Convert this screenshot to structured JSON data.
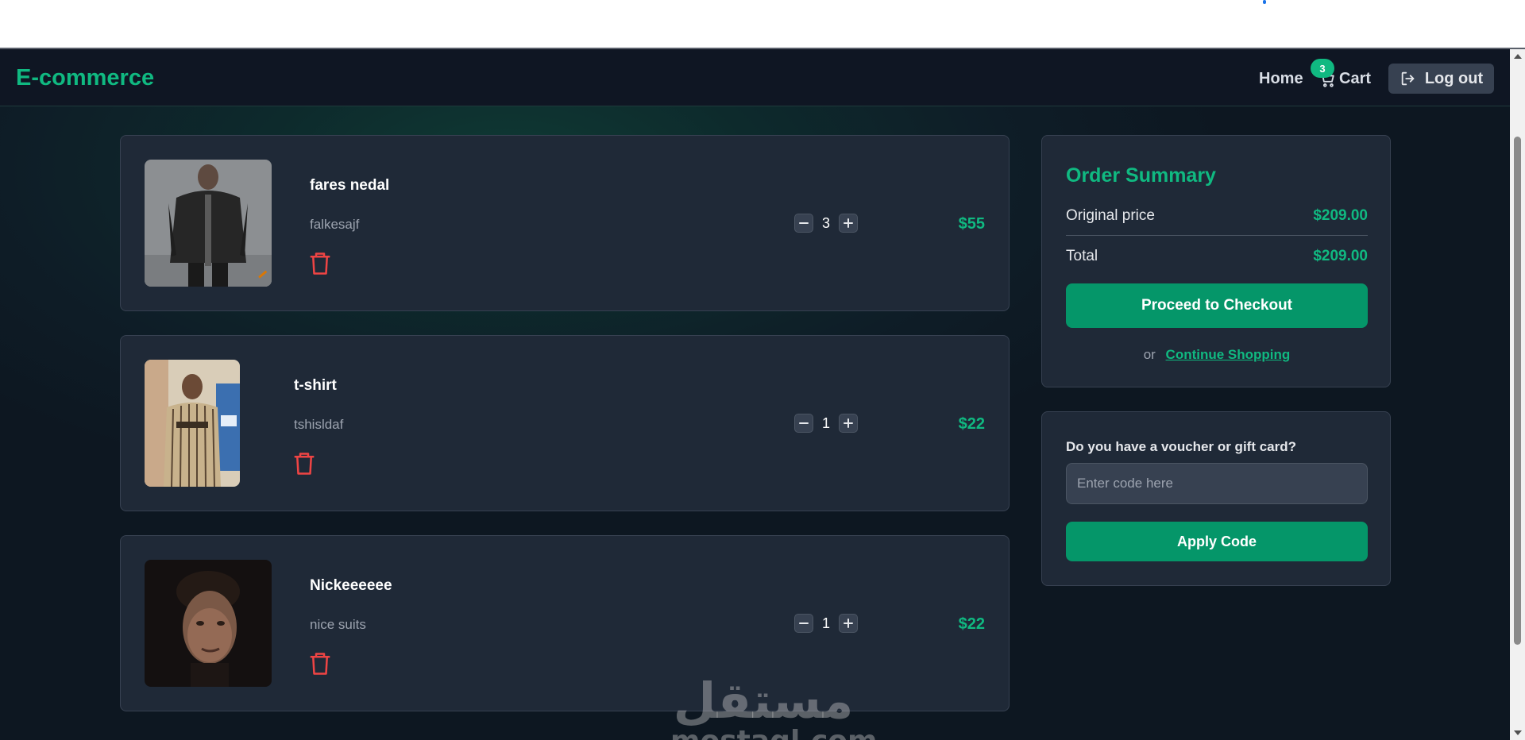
{
  "navbar": {
    "brand": "E-commerce",
    "home_label": "Home",
    "cart_label": "Cart",
    "cart_count": "3",
    "logout_label": "Log out"
  },
  "cart": {
    "items": [
      {
        "name": "fares nedal",
        "description": "falkesajf",
        "quantity": "3",
        "price": "$55"
      },
      {
        "name": "t-shirt",
        "description": "tshisldaf",
        "quantity": "1",
        "price": "$22"
      },
      {
        "name": "Nickeeeeee",
        "description": "nice suits",
        "quantity": "1",
        "price": "$22"
      }
    ]
  },
  "summary": {
    "title": "Order Summary",
    "original_label": "Original price",
    "original_value": "$209.00",
    "total_label": "Total",
    "total_value": "$209.00",
    "checkout_label": "Proceed to Checkout",
    "or_label": "or",
    "continue_label": "Continue Shopping"
  },
  "voucher": {
    "label": "Do you have a voucher or gift card?",
    "placeholder": "Enter code here",
    "apply_label": "Apply Code"
  },
  "watermark": {
    "arabic": "مستقل",
    "latin": "mostaql.com"
  },
  "colors": {
    "accent": "#10b981",
    "button": "#059669",
    "card": "#1f2937",
    "trash": "#ef4444"
  }
}
